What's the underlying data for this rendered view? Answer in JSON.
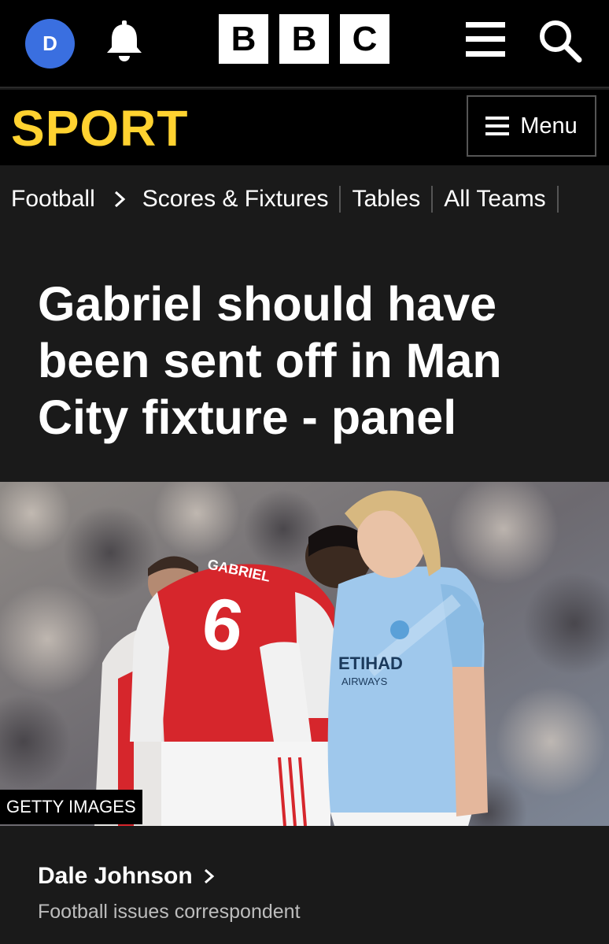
{
  "topbar": {
    "avatar_initial": "D",
    "logo_letters": [
      "B",
      "B",
      "C"
    ],
    "icons": [
      "bell-icon",
      "hamburger-icon",
      "search-icon"
    ]
  },
  "sportbar": {
    "title": "SPORT",
    "title_color": "#ffd230",
    "menu_label": "Menu"
  },
  "breadcrumb": {
    "items": [
      "Football",
      "Scores & Fixtures",
      "Tables",
      "All Teams"
    ]
  },
  "article": {
    "headline": "Gabriel should have been sent off in Man City fixture - panel",
    "image_credit": "GETTY IMAGES",
    "image_text": {
      "shirt_name": "GABRIEL",
      "shirt_number": "6",
      "sponsor": "ETIHAD",
      "sponsor_sub": "AIRWAYS"
    },
    "author": "Dale Johnson",
    "author_role": "Football issues correspondent"
  },
  "colors": {
    "background": "#1a1a1a",
    "bar": "#000000",
    "avatar": "#3a6fe0",
    "arsenal_red": "#d6262c",
    "city_blue": "#9fc8ec"
  }
}
